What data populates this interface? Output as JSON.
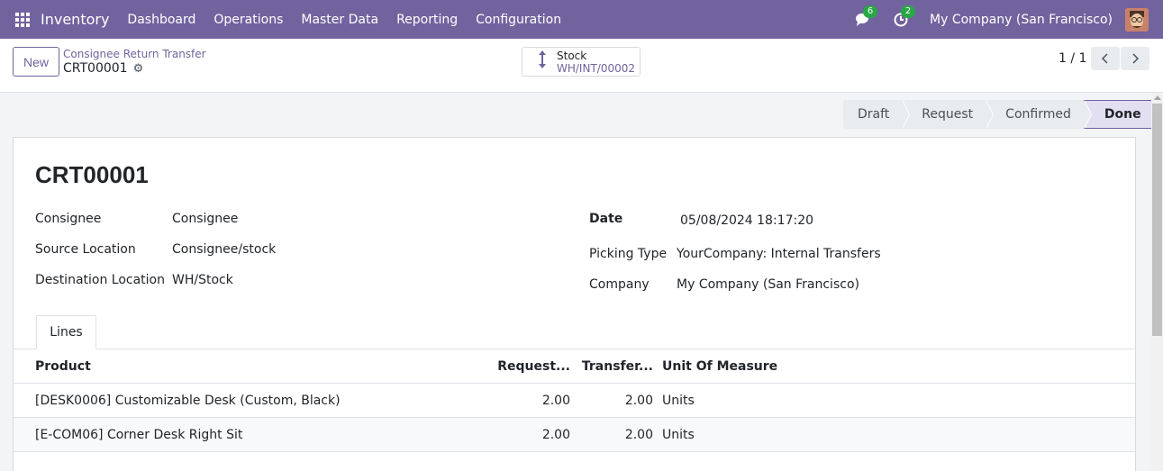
{
  "navbar": {
    "app_name": "Inventory",
    "menu": [
      "Dashboard",
      "Operations",
      "Master Data",
      "Reporting",
      "Configuration"
    ],
    "messages_count": "6",
    "activities_count": "2",
    "company": "My Company (San Francisco)"
  },
  "control_panel": {
    "new_label": "New",
    "breadcrumb": "Consignee Return Transfer",
    "record_name": "CRT00001",
    "smart_button": {
      "title": "Stock",
      "value": "WH/INT/00002"
    },
    "pager": "1 / 1"
  },
  "status": {
    "stages": [
      "Draft",
      "Request",
      "Confirmed",
      "Done"
    ],
    "active": "Done"
  },
  "form": {
    "title": "CRT00001",
    "left_fields": [
      {
        "label": "Consignee",
        "value": "Consignee"
      },
      {
        "label": "Source Location",
        "value": "Consignee/stock"
      },
      {
        "label": "Destination Location",
        "value": "WH/Stock"
      }
    ],
    "right_fields": [
      {
        "label": "Date",
        "value": "05/08/2024 18:17:20"
      },
      {
        "label": "Picking Type",
        "value": "YourCompany: Internal Transfers"
      },
      {
        "label": "Company",
        "value": "My Company (San Francisco)"
      }
    ]
  },
  "tabs": [
    "Lines"
  ],
  "lines": {
    "columns": [
      "Product",
      "Request...",
      "Transfer...",
      "Unit Of Measure"
    ],
    "rows": [
      {
        "product": "[DESK0006] Customizable Desk (Custom, Black)",
        "requested": "2.00",
        "transferred": "2.00",
        "uom": "Units"
      },
      {
        "product": "[E-COM06] Corner Desk Right Sit",
        "requested": "2.00",
        "transferred": "2.00",
        "uom": "Units"
      }
    ]
  },
  "colors": {
    "brand": "#71639e",
    "badge": "#28a745"
  }
}
